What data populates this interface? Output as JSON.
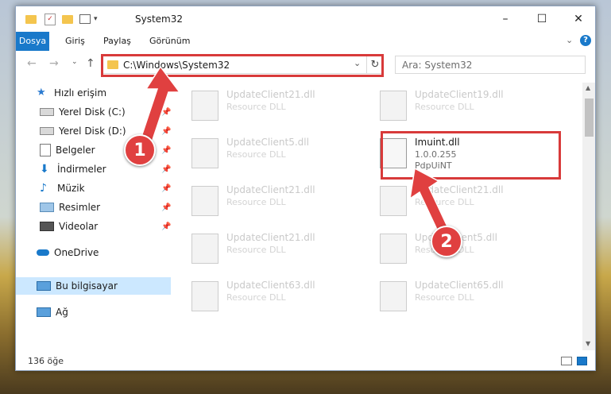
{
  "window": {
    "title": "System32",
    "controls": {
      "minimize": "–",
      "maximize": "☐",
      "close": "✕"
    }
  },
  "ribbon": {
    "tabs": [
      {
        "label": "Dosya",
        "active": true
      },
      {
        "label": "Giriş",
        "active": false
      },
      {
        "label": "Paylaş",
        "active": false
      },
      {
        "label": "Görünüm",
        "active": false
      }
    ]
  },
  "address": {
    "path": "C:\\Windows\\System32"
  },
  "search": {
    "placeholder": "Ara: System32"
  },
  "sidebar": {
    "items": [
      {
        "label": "Hızlı erişim",
        "icon": "star-icon",
        "pinned": false
      },
      {
        "label": "Yerel Disk (C:)",
        "icon": "drive-icon",
        "pinned": true
      },
      {
        "label": "Yerel Disk (D:)",
        "icon": "drive-icon",
        "pinned": true
      },
      {
        "label": "Belgeler",
        "icon": "document-icon",
        "pinned": true
      },
      {
        "label": "İndirmeler",
        "icon": "download-icon",
        "pinned": true
      },
      {
        "label": "Müzik",
        "icon": "music-icon",
        "pinned": true
      },
      {
        "label": "Resimler",
        "icon": "pictures-icon",
        "pinned": true
      },
      {
        "label": "Videolar",
        "icon": "video-icon",
        "pinned": true
      },
      {
        "label": "OneDrive",
        "icon": "cloud-icon",
        "pinned": false
      },
      {
        "label": "Bu bilgisayar",
        "icon": "computer-icon",
        "pinned": false
      },
      {
        "label": "Ağ",
        "icon": "network-icon",
        "pinned": false
      }
    ]
  },
  "files": [
    {
      "name": "UpdateClient21.dll",
      "desc": "Resource DLL"
    },
    {
      "name": "UpdateClient19.dll",
      "desc": "Resource DLL"
    },
    {
      "name": "UpdateClient5.dll",
      "desc": "Resource DLL"
    },
    {
      "name": "Imuint.dll",
      "version": "1.0.0.255",
      "company": "PdpUiNT",
      "selected": true
    },
    {
      "name": "UpdateClient21.dll",
      "desc": "Resource DLL"
    },
    {
      "name": "UpdateClient21.dll",
      "desc": "Resource DLL"
    },
    {
      "name": "UpdateClient21.dll",
      "desc": "Resource DLL"
    },
    {
      "name": "UpdateClient5.dll",
      "desc": "Resource DLL"
    },
    {
      "name": "UpdateClient63.dll",
      "desc": "Resource DLL"
    },
    {
      "name": "UpdateClient65.dll",
      "desc": "Resource DLL"
    }
  ],
  "status": {
    "count": "136 öğe"
  },
  "annotations": {
    "step1": "1",
    "step2": "2"
  },
  "colors": {
    "accent": "#1979ca",
    "highlight": "#d83a3a",
    "selected_sidebar": "#cce8ff"
  }
}
